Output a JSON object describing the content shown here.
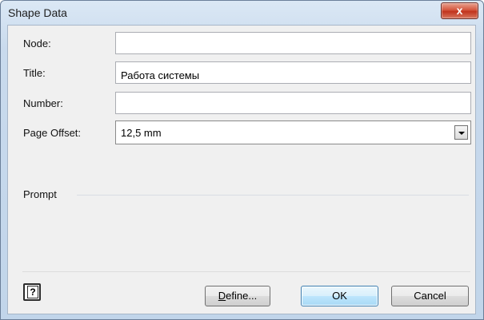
{
  "window": {
    "title": "Shape Data",
    "close_glyph": "x"
  },
  "fields": [
    {
      "label": "Node:",
      "value": ""
    },
    {
      "label": "Title:",
      "value": "Работа системы"
    },
    {
      "label": "Number:",
      "value": ""
    }
  ],
  "page_offset": {
    "label": "Page Offset:",
    "value": "12,5 mm"
  },
  "prompt": {
    "label": "Prompt"
  },
  "buttons": {
    "help_glyph": "?",
    "define_first": "D",
    "define_rest": "efine...",
    "ok": "OK",
    "cancel": "Cancel"
  },
  "icons": {
    "help": "help-icon",
    "dropdown": "chevron-down-icon",
    "close": "close-icon"
  }
}
